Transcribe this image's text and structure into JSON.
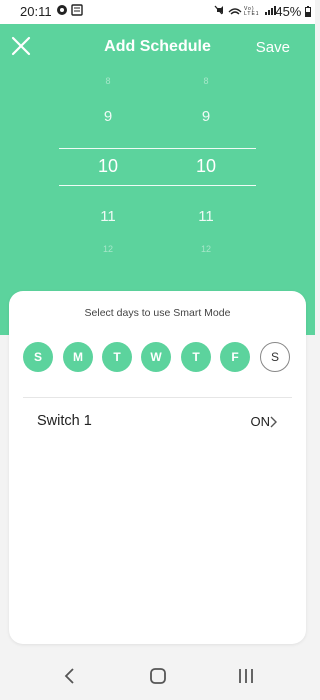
{
  "status_bar": {
    "time": "20:11",
    "right_icons": "Vo) LTE1",
    "battery": "45%"
  },
  "header": {
    "close_icon": "close-icon",
    "title": "Add Schedule",
    "save_label": "Save"
  },
  "picker": {
    "hours": [
      "8",
      "9",
      "10",
      "11",
      "12"
    ],
    "minutes": [
      "8",
      "9",
      "10",
      "11",
      "12"
    ],
    "selected_hour": "10",
    "selected_minute": "10"
  },
  "card": {
    "prompt": "Select days to use Smart Mode",
    "days": [
      {
        "label": "S",
        "selected": true
      },
      {
        "label": "M",
        "selected": true
      },
      {
        "label": "T",
        "selected": true
      },
      {
        "label": "W",
        "selected": true
      },
      {
        "label": "T",
        "selected": true
      },
      {
        "label": "F",
        "selected": true
      },
      {
        "label": "S",
        "selected": false
      }
    ],
    "switch_row": {
      "label": "Switch 1",
      "state": "ON"
    }
  },
  "colors": {
    "accent": "#5cd39d",
    "card_bg": "#ffffff",
    "nav_bg": "#f3f3f3"
  }
}
